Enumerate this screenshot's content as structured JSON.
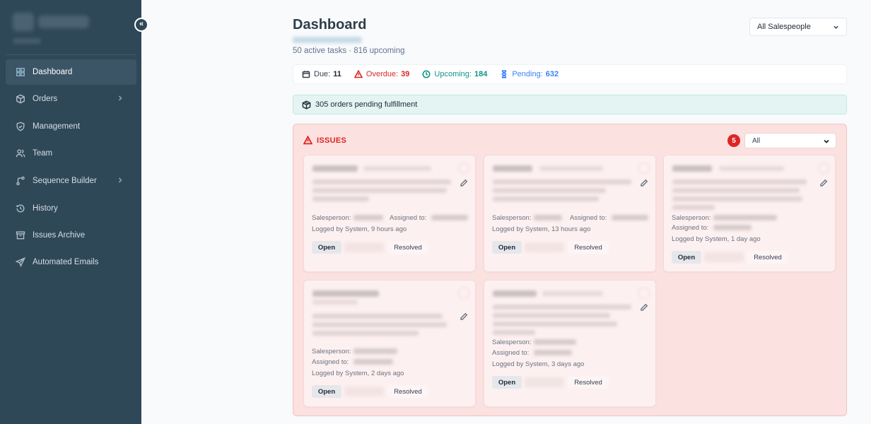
{
  "sidebar": {
    "collapse_glyph": "«",
    "items": [
      {
        "label": "Dashboard",
        "icon": "grid-icon",
        "active": true
      },
      {
        "label": "Orders",
        "icon": "box-icon",
        "has_submenu": true
      },
      {
        "label": "Management",
        "icon": "shield-icon"
      },
      {
        "label": "Team",
        "icon": "users-icon"
      },
      {
        "label": "Sequence Builder",
        "icon": "branch-icon",
        "has_submenu": true
      },
      {
        "label": "History",
        "icon": "history-icon"
      },
      {
        "label": "Issues Archive",
        "icon": "archive-icon"
      },
      {
        "label": "Automated Emails",
        "icon": "send-icon"
      }
    ]
  },
  "header": {
    "title": "Dashboard",
    "summary": "50 active tasks · 816 upcoming",
    "salesperson_filter": "All Salespeople"
  },
  "stats": {
    "due_label": "Due:",
    "due_value": "11",
    "overdue_label": "Overdue:",
    "overdue_value": "39",
    "upcoming_label": "Upcoming:",
    "upcoming_value": "184",
    "pending_label": "Pending:",
    "pending_value": "632"
  },
  "pending_bar": {
    "text": "305 orders pending fulfillment"
  },
  "issues": {
    "title": "ISSUES",
    "count": "5",
    "filter_value": "All",
    "cards": [
      {
        "salesperson_label": "Salesperson:",
        "assigned_label": "Assigned to:",
        "logged": "Logged by System, 9 hours ago",
        "open_label": "Open",
        "resolved_label": "Resolved"
      },
      {
        "salesperson_label": "Salesperson:",
        "assigned_label": "Assigned to:",
        "logged": "Logged by System, 13 hours ago",
        "open_label": "Open",
        "resolved_label": "Resolved"
      },
      {
        "salesperson_label": "Salesperson:",
        "assigned_label": "Assigned to:",
        "logged": "Logged by System, 1 day ago",
        "open_label": "Open",
        "resolved_label": "Resolved"
      },
      {
        "salesperson_label": "Salesperson:",
        "assigned_label": "Assigned to:",
        "logged": "Logged by System, 2 days ago",
        "open_label": "Open",
        "resolved_label": "Resolved"
      },
      {
        "salesperson_label": "Salesperson:",
        "assigned_label": "Assigned to:",
        "logged": "Logged by System, 3 days ago",
        "open_label": "Open",
        "resolved_label": "Resolved"
      }
    ]
  },
  "colors": {
    "sidebar_bg": "#2f4858",
    "overdue": "#dc2626",
    "upcoming": "#0f9488",
    "pending": "#3b82f6",
    "issues_bg": "#fbe1e0"
  }
}
